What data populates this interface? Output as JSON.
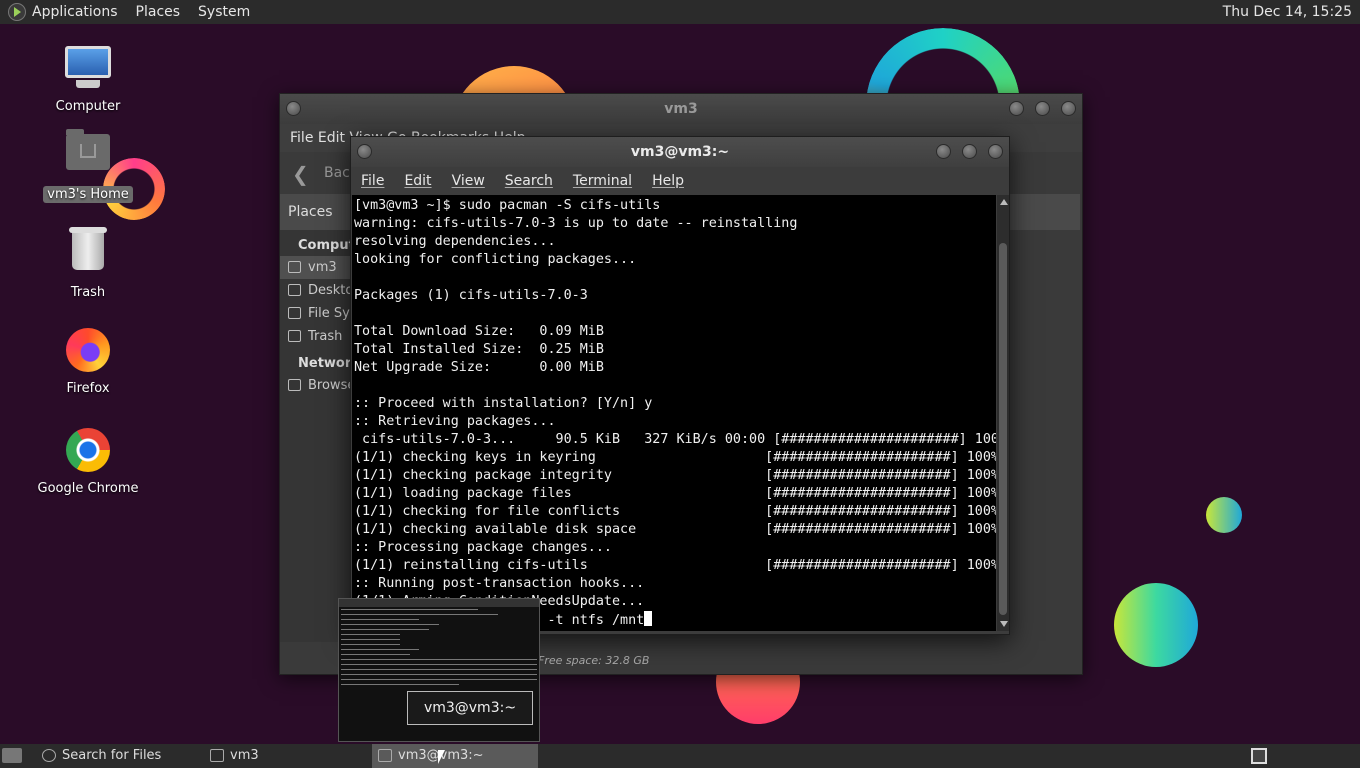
{
  "top_panel": {
    "menus": [
      "Applications",
      "Places",
      "System"
    ],
    "clock": "Thu Dec 14, 15:25"
  },
  "desktop": {
    "icons": [
      {
        "label": "Computer",
        "icon": "computer-icon"
      },
      {
        "label": "vm3's Home",
        "icon": "home-folder-icon"
      },
      {
        "label": "Trash",
        "icon": "trash-icon"
      },
      {
        "label": "Firefox",
        "icon": "firefox-icon"
      },
      {
        "label": "Google Chrome",
        "icon": "chrome-icon"
      }
    ]
  },
  "file_manager": {
    "title": "vm3",
    "menu": "File   Edit   View   Go   Bookmarks   Help",
    "back_label": "Back",
    "places_header": "Places",
    "sections": {
      "computer": "Computer",
      "network": "Network"
    },
    "items": [
      "vm3",
      "Desktop",
      "File System",
      "Trash"
    ],
    "network_items": [
      "Browse Network"
    ],
    "status": "Free space: 32.8 GB"
  },
  "terminal": {
    "title": "vm3@vm3:~",
    "menu": [
      "File",
      "Edit",
      "View",
      "Search",
      "Terminal",
      "Help"
    ],
    "lines": [
      "[vm3@vm3 ~]$ sudo pacman -S cifs-utils",
      "warning: cifs-utils-7.0-3 is up to date -- reinstalling",
      "resolving dependencies...",
      "looking for conflicting packages...",
      "",
      "Packages (1) cifs-utils-7.0-3",
      "",
      "Total Download Size:   0.09 MiB",
      "Total Installed Size:  0.25 MiB",
      "Net Upgrade Size:      0.00 MiB",
      "",
      ":: Proceed with installation? [Y/n] y",
      ":: Retrieving packages...",
      " cifs-utils-7.0-3...     90.5 KiB   327 KiB/s 00:00 [######################] 100%",
      "(1/1) checking keys in keyring                     [######################] 100%",
      "(1/1) checking package integrity                   [######################] 100%",
      "(1/1) loading package files                        [######################] 100%",
      "(1/1) checking for file conflicts                  [######################] 100%",
      "(1/1) checking available disk space                [######################] 100%",
      ":: Processing package changes...",
      "(1/1) reinstalling cifs-utils                      [######################] 100%",
      ":: Running post-transaction hooks...",
      "(1/1) Arming ConditionNeedsUpdate...",
      "[vm3@vm3 ~]$ sudo mount -t ntfs /mnt"
    ]
  },
  "taskbar": {
    "items": [
      "Search for Files",
      "vm3",
      "vm3@vm3:~"
    ],
    "preview_tooltip": "vm3@vm3:~"
  }
}
